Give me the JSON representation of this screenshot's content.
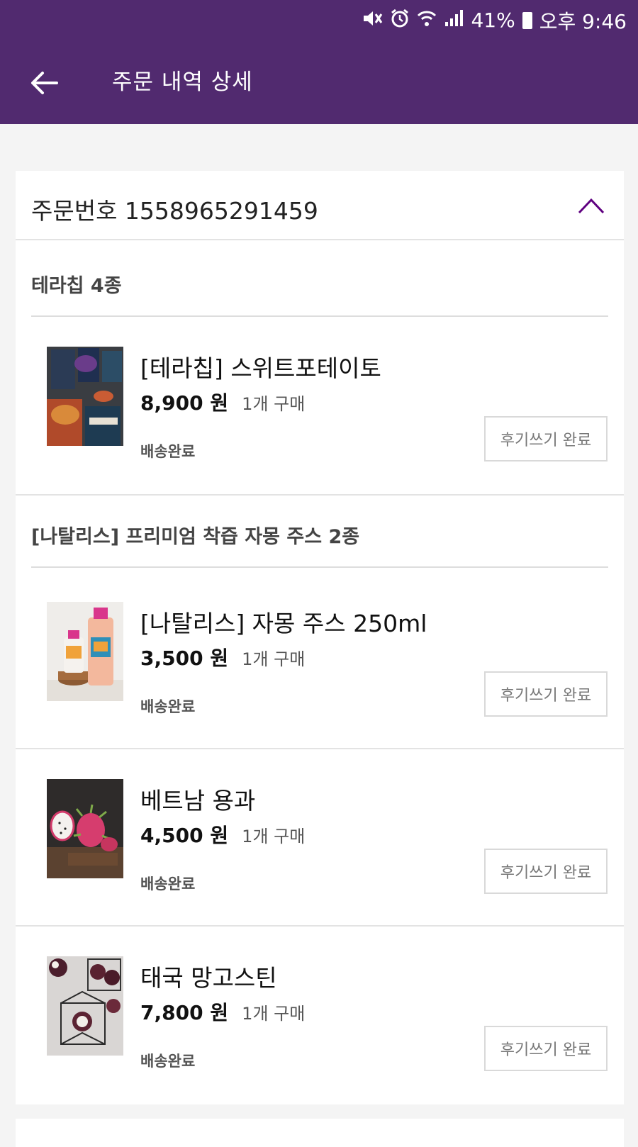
{
  "status_bar": {
    "battery": "41%",
    "time": "오후 9:46"
  },
  "header": {
    "title": "주문 내역 상세"
  },
  "order": {
    "number_label": "주문번호 1558965291459"
  },
  "groups": [
    {
      "title": "테라칩 4종",
      "items": [
        {
          "name": "[테라칩] 스위트포테이토",
          "price": "8,900 원",
          "qty": "1개 구매",
          "status": "배송완료",
          "review": "후기쓰기 완료"
        }
      ]
    },
    {
      "title": "[나탈리스] 프리미엄 착즙 자몽 주스 2종",
      "items": [
        {
          "name": "[나탈리스] 자몽 주스 250ml",
          "price": "3,500 원",
          "qty": "1개 구매",
          "status": "배송완료",
          "review": "후기쓰기 완료"
        }
      ]
    },
    {
      "title": "",
      "items": [
        {
          "name": "베트남 용과",
          "price": "4,500 원",
          "qty": "1개 구매",
          "status": "배송완료",
          "review": "후기쓰기 완료"
        }
      ]
    },
    {
      "title": "",
      "items": [
        {
          "name": "태국 망고스틴",
          "price": "7,800 원",
          "qty": "1개 구매",
          "status": "배송완료",
          "review": "후기쓰기 완료"
        }
      ]
    }
  ],
  "icons": {
    "back": "arrow-left-icon",
    "collapse": "chevron-up-icon",
    "mute": "mute-icon",
    "alarm": "alarm-icon",
    "wifi": "wifi-icon",
    "signal": "signal-icon",
    "battery": "battery-icon"
  },
  "colors": {
    "brand": "#512a6f",
    "accent": "#5f0080"
  }
}
